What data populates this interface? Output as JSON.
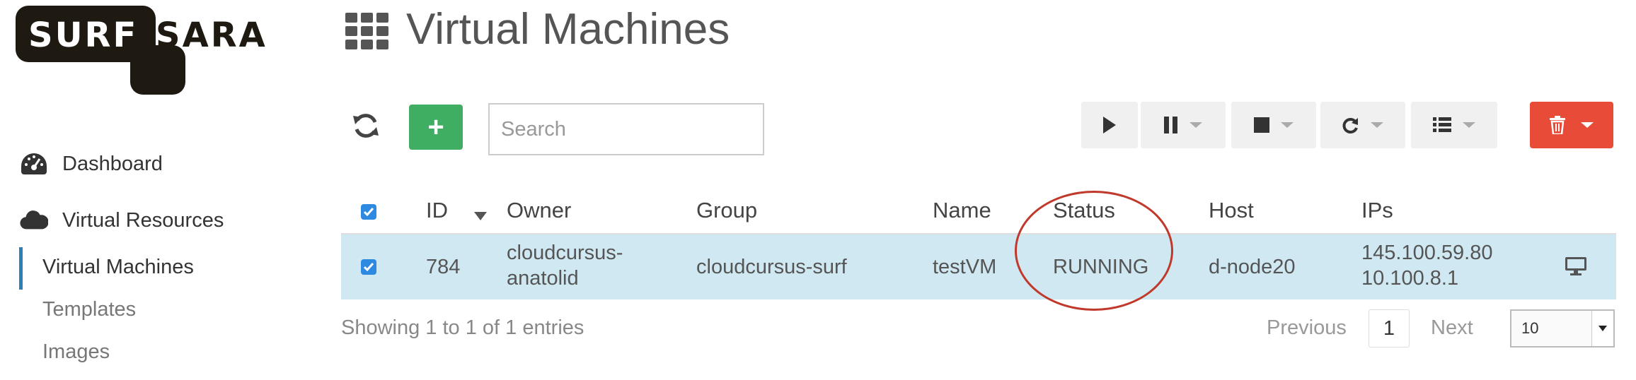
{
  "logo": {
    "left_text": "SURF",
    "right_text": "SARA",
    "color": "#1e1a12"
  },
  "sidebar": {
    "items": [
      {
        "label": "Dashboard",
        "icon": "dashboard-gauge-icon"
      },
      {
        "label": "Virtual Resources",
        "icon": "cloud-icon"
      }
    ],
    "sub_items": [
      {
        "label": "Virtual Machines",
        "active": true
      },
      {
        "label": "Templates",
        "active": false
      },
      {
        "label": "Images",
        "active": false
      }
    ],
    "accent": "#2e7fb8"
  },
  "page": {
    "title": "Virtual Machines",
    "icon": "grid-icon"
  },
  "toolbar": {
    "refresh_icon": "refresh-icon",
    "add_label": "+",
    "add_color": "#3fae62",
    "search_placeholder": "Search",
    "search_value": "",
    "buttons": [
      "play-icon",
      "pause-icon",
      "stop-icon",
      "reboot-icon",
      "list-icon"
    ],
    "delete_icon": "trash-icon",
    "delete_color": "#e84b38"
  },
  "table": {
    "columns": [
      "ID",
      "Owner",
      "Group",
      "Name",
      "Status",
      "Host",
      "IPs"
    ],
    "sort_column": "ID",
    "sort_direction": "desc",
    "select_all_checked": true,
    "rows": [
      {
        "checked": true,
        "id": "784",
        "owner_line1": "cloudcursus-",
        "owner_line2": "anatolid",
        "group": "cloudcursus-surf",
        "name": "testVM",
        "status": "RUNNING",
        "host": "d-node20",
        "ip1": "145.100.59.80",
        "ip2": "10.100.8.1",
        "action_icon": "monitor-icon"
      }
    ],
    "row_highlight": "#cfe8f2"
  },
  "footer": {
    "info": "Showing 1 to 1 of 1 entries",
    "previous": "Previous",
    "current_page": "1",
    "next": "Next",
    "page_size": "10"
  }
}
